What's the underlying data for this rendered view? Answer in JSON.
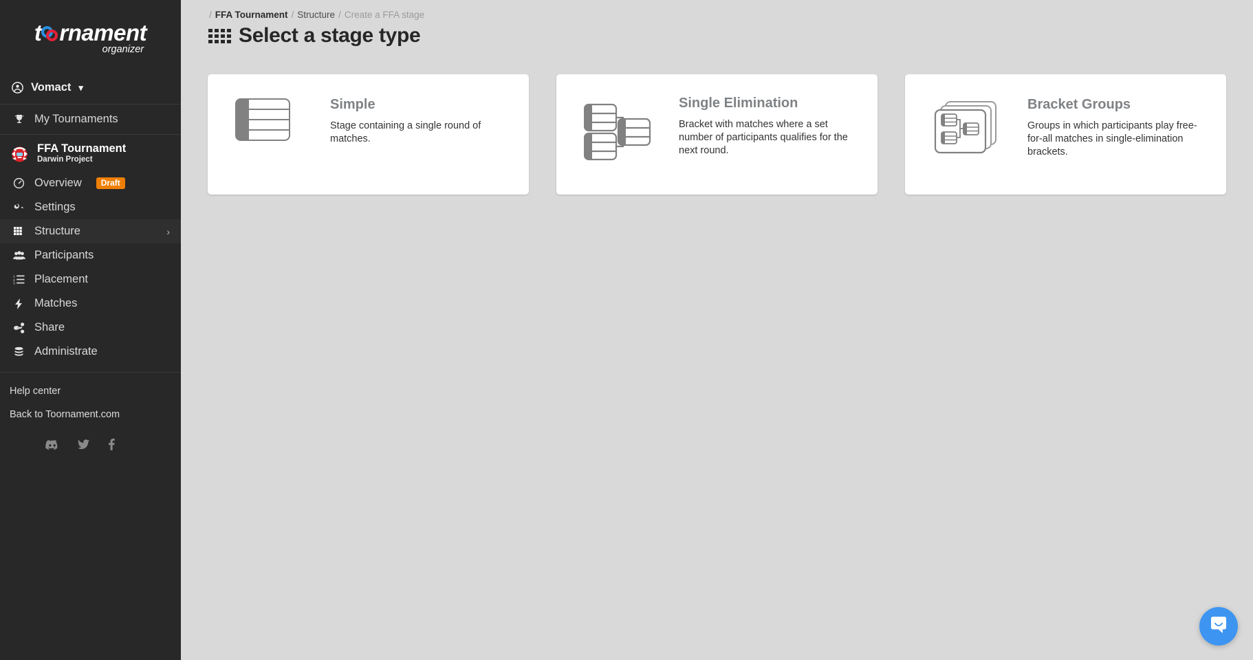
{
  "brand": {
    "logo_main": "toornament",
    "logo_sub": "organizer",
    "accent_blue": "#2b8fe0",
    "accent_red": "#e2213a"
  },
  "sidebar": {
    "user": {
      "name": "Vomact",
      "avatar_icon": "user-circle-icon",
      "caret_icon": "chevron-down-icon"
    },
    "top_nav": [
      {
        "label": "My Tournaments",
        "icon": "trophy-icon"
      }
    ],
    "tournament": {
      "name": "FFA Tournament",
      "game": "Darwin Project",
      "avatar_icon": "game-avatar-icon"
    },
    "nav": [
      {
        "label": "Overview",
        "icon": "dashboard-icon",
        "badge": "Draft",
        "badge_color": "#ef7f04",
        "active": false
      },
      {
        "label": "Settings",
        "icon": "gears-icon",
        "badge": "",
        "active": false
      },
      {
        "label": "Structure",
        "icon": "grid-icon",
        "badge": "",
        "active": true,
        "chevron": "›"
      },
      {
        "label": "Participants",
        "icon": "users-icon",
        "badge": "",
        "active": false
      },
      {
        "label": "Placement",
        "icon": "ordered-list-icon",
        "badge": "",
        "active": false
      },
      {
        "label": "Matches",
        "icon": "bolt-icon",
        "badge": "",
        "active": false
      },
      {
        "label": "Share",
        "icon": "share-icon",
        "badge": "",
        "active": false
      },
      {
        "label": "Administrate",
        "icon": "database-icon",
        "badge": "",
        "active": false
      }
    ],
    "footer_links": [
      {
        "label": "Help center"
      },
      {
        "label": "Back to Toornament.com"
      }
    ],
    "socials": [
      {
        "name": "discord-icon"
      },
      {
        "name": "twitter-icon"
      },
      {
        "name": "facebook-icon"
      }
    ]
  },
  "main": {
    "breadcrumb": {
      "lead": "/",
      "items": [
        {
          "label": "FFA Tournament"
        },
        {
          "label": "Structure"
        },
        {
          "label": "Create a FFA stage"
        }
      ],
      "separator": "/"
    },
    "title": "Select a stage type",
    "title_icon": "grid-icon",
    "cards": [
      {
        "title": "Simple",
        "description": "Stage containing a single round of matches.",
        "icon": "simple-stage-icon"
      },
      {
        "title": "Single Elimination",
        "description": "Bracket with matches where a set number of participants qualifies for the next round.",
        "icon": "single-elimination-icon"
      },
      {
        "title": "Bracket Groups",
        "description": "Groups in which participants play free-for-all matches in single-elimination brackets.",
        "icon": "bracket-groups-icon"
      }
    ]
  },
  "chat": {
    "icon": "chat-bubble-icon",
    "color": "#3d95f1"
  }
}
